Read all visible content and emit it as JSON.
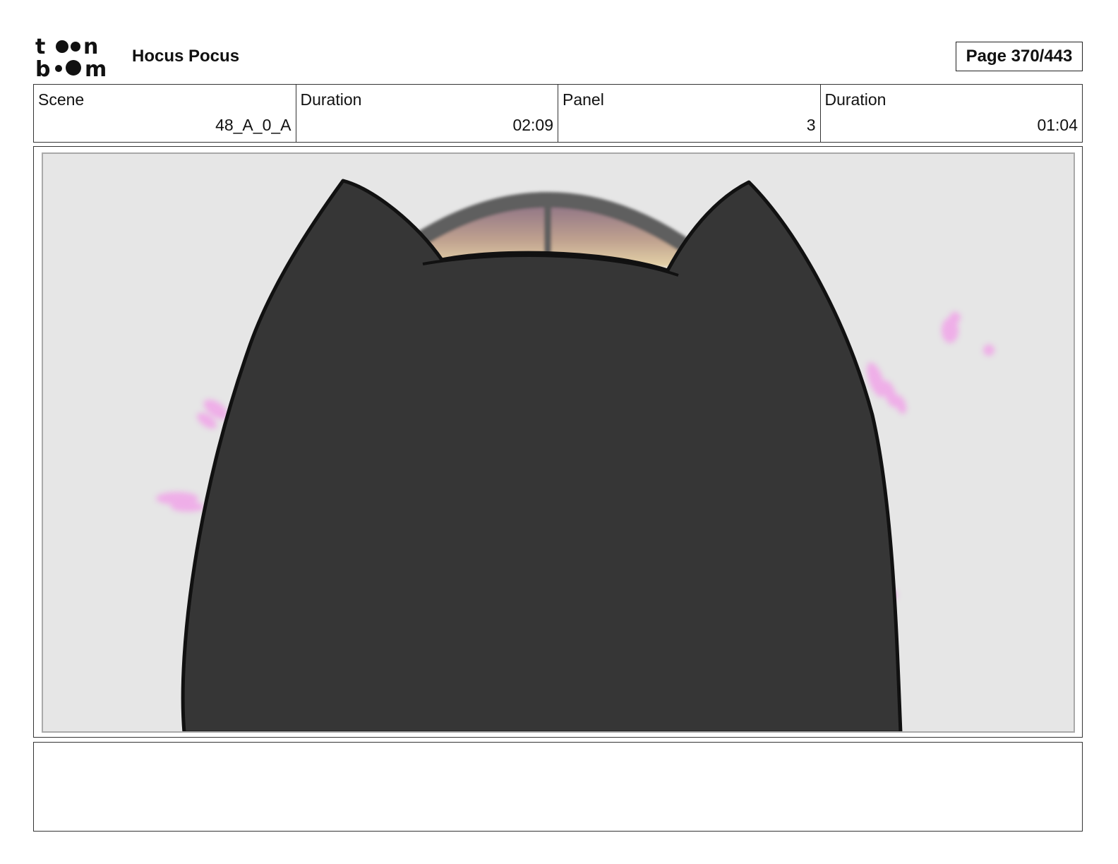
{
  "header": {
    "logo": {
      "top_text": "toon",
      "bottom_text": "boom"
    },
    "title": "Hocus Pocus",
    "page": "Page 370/443"
  },
  "info": [
    {
      "label": "Scene",
      "value": "48_A_0_A"
    },
    {
      "label": "Duration",
      "value": "02:09"
    },
    {
      "label": "Panel",
      "value": "3"
    },
    {
      "label": "Duration",
      "value": "01:04"
    }
  ],
  "panel": {
    "content": "cat-silhouette-back-view",
    "colors": {
      "background": "#e6e6e6",
      "cat": "#363636",
      "window_frame": "#5e5e5e",
      "sparkles": "#f0a8e8"
    }
  },
  "notes": {
    "text": ""
  }
}
